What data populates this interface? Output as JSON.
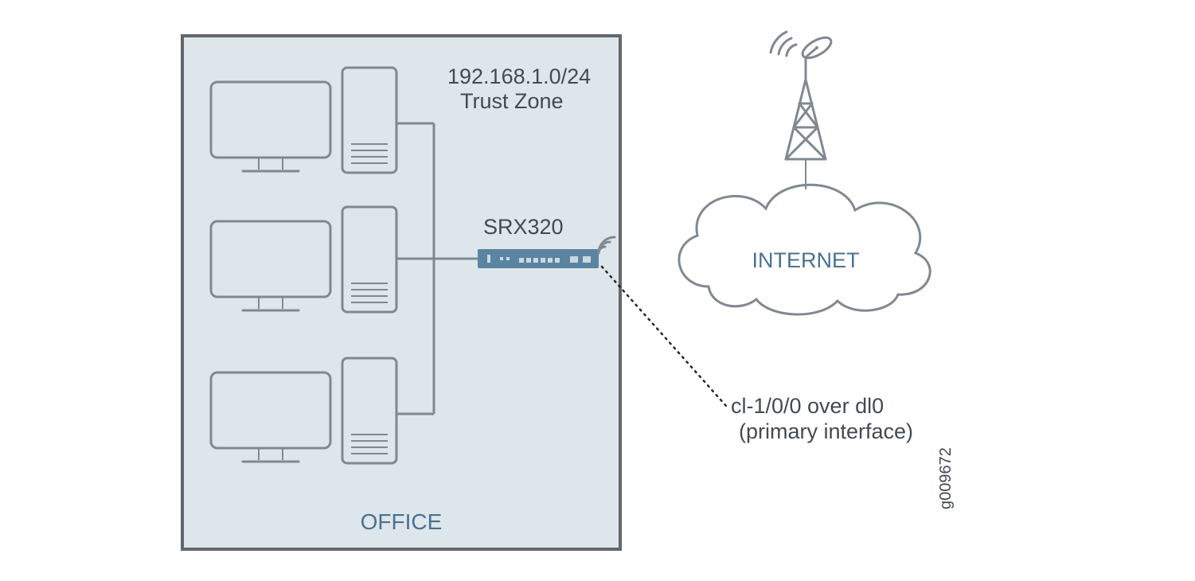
{
  "office": {
    "title": "OFFICE",
    "subnet": "192.168.1.0/24",
    "zone": "Trust Zone",
    "device": "SRX320"
  },
  "internet": {
    "label": "INTERNET"
  },
  "interface": {
    "line1": "cl-1/0/0 over dl0",
    "line2": "(primary interface)"
  },
  "figure_id": "g009672",
  "colors": {
    "frame": "#62676d",
    "icon_stroke": "#808891",
    "office_fill": "#dde6eb",
    "text_dark": "#444a51",
    "text_blue": "#49728f",
    "srx_fill": "#5b84a1"
  }
}
